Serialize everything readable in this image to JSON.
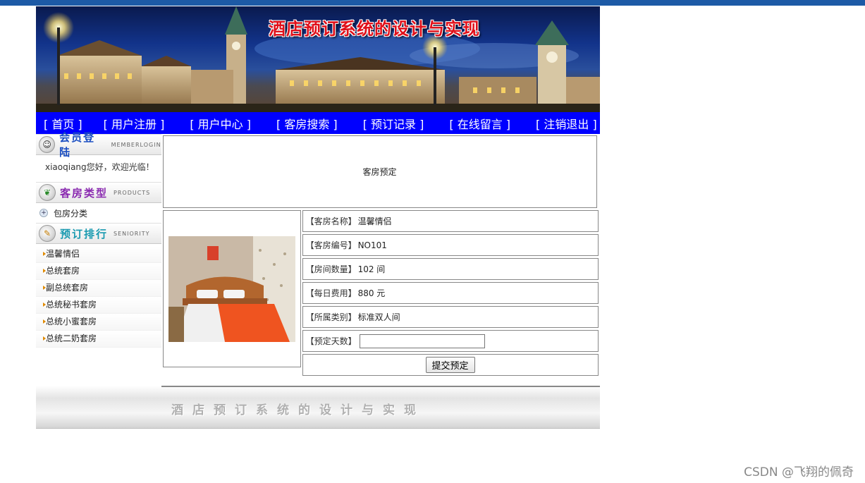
{
  "banner": {
    "title": "酒店预订系统的设计与实现"
  },
  "nav": [
    "[ 首页 ]",
    "[ 用户注册 ]",
    "[ 用户中心 ]",
    "[ 客房搜索 ]",
    "[ 预订记录 ]",
    "[ 在线留言 ]",
    "[ 注销退出 ]"
  ],
  "sidebar": {
    "member": {
      "title": "会员登陆",
      "en": "MEMBERLOGIN",
      "welcome": "xiaoqiang您好，欢迎光临！"
    },
    "types": {
      "title": "客房类型",
      "en": "PRODUCTS",
      "items": [
        "包房分类"
      ]
    },
    "ranking": {
      "title": "预订排行",
      "en": "SENIORITY",
      "items": [
        "温馨情侣",
        "总统套房",
        "副总统套房",
        "总统秘书套房",
        "总统小蜜套房",
        "总统二奶套房"
      ]
    }
  },
  "main": {
    "title": "客房预定",
    "room": {
      "name_label": "【客房名称】",
      "name": "温馨情侣",
      "code_label": "【客房编号】",
      "code": "NO101",
      "count_label": "【房间数量】",
      "count": "102 间",
      "fee_label": "【每日费用】",
      "fee": "880 元",
      "category_label": "【所属类别】",
      "category": "标准双人间",
      "days_label": "【预定天数】",
      "days_value": ""
    },
    "submit_label": "提交预定"
  },
  "footer": {
    "text": "酒店预订系统的设计与实现"
  },
  "watermark": "CSDN @飞翔的佩奇",
  "colors": {
    "nav_bg": "#0000ff",
    "top_strip": "#1d5aa6",
    "title_red": "#e0101a"
  },
  "icons": {
    "member": "user-icon",
    "types": "leaf-icon",
    "ranking": "pen-icon",
    "category": "plus-icon",
    "ranking_item": "arrow-right-icon"
  }
}
